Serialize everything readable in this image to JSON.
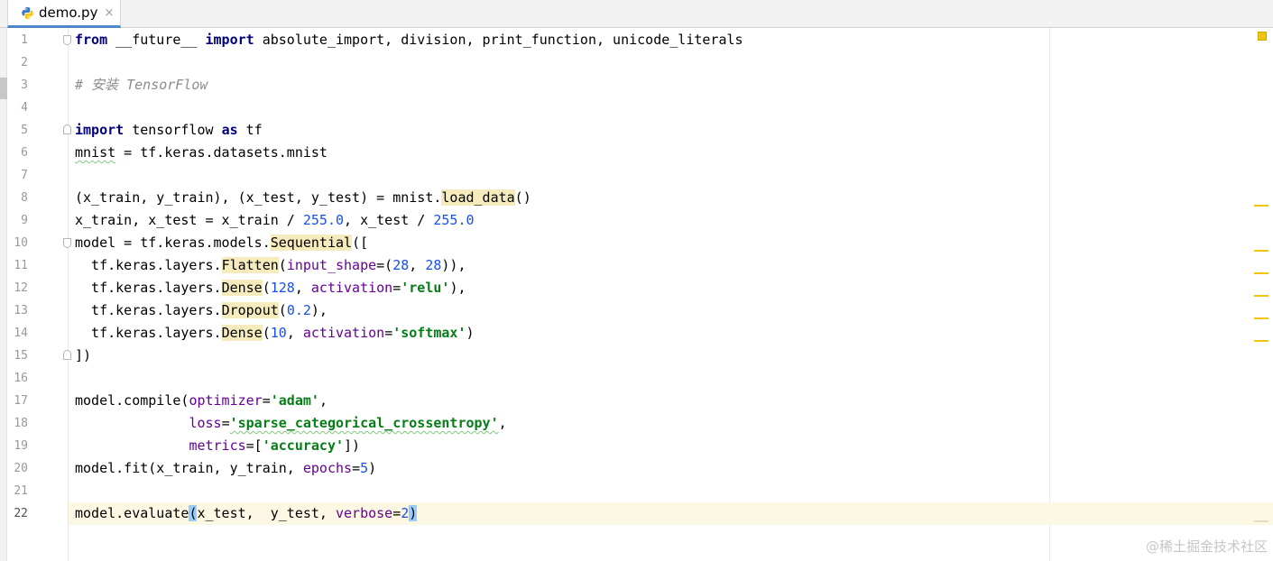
{
  "tab": {
    "file_name": "demo.py",
    "close_glyph": "×",
    "icon": "python-file-icon"
  },
  "colors": {
    "keyword": "#000080",
    "number": "#1750eb",
    "string": "#067d17",
    "kwarg": "#660099",
    "comment": "#8c8c8c",
    "usage_highlight": "#f6ebbc",
    "brace_match": "#99ccff",
    "current_line": "#fdf8e4",
    "warning": "#f1c40f"
  },
  "editor": {
    "current_line": 22,
    "lines": [
      {
        "n": "1",
        "fold": "start",
        "tokens": [
          {
            "t": "from",
            "c": "kw"
          },
          {
            "t": " __future__ "
          },
          {
            "t": "import",
            "c": "kw"
          },
          {
            "t": " absolute_import, division, print_function, unicode_literals"
          }
        ]
      },
      {
        "n": "2",
        "tokens": []
      },
      {
        "n": "3",
        "tokens": [
          {
            "t": "# 安装 TensorFlow",
            "c": "cmt"
          }
        ]
      },
      {
        "n": "4",
        "tokens": []
      },
      {
        "n": "5",
        "fold": "end",
        "tokens": [
          {
            "t": "import",
            "c": "kw"
          },
          {
            "t": " tensorflow "
          },
          {
            "t": "as",
            "c": "kw"
          },
          {
            "t": " tf"
          }
        ]
      },
      {
        "n": "6",
        "tokens": [
          {
            "t": "mnist",
            "c": "typo"
          },
          {
            "t": " = tf.keras.datasets.mnist"
          }
        ]
      },
      {
        "n": "7",
        "tokens": []
      },
      {
        "n": "8",
        "tokens": [
          {
            "t": "(x_train, y_train), (x_test, y_test) = mnist."
          },
          {
            "t": "load_data",
            "c": "hl"
          },
          {
            "t": "()"
          }
        ]
      },
      {
        "n": "9",
        "tokens": [
          {
            "t": "x_train, x_test = x_train / "
          },
          {
            "t": "255.0",
            "c": "num"
          },
          {
            "t": ", x_test / "
          },
          {
            "t": "255.0",
            "c": "num"
          }
        ]
      },
      {
        "n": "10",
        "fold": "start",
        "tokens": [
          {
            "t": "model = tf.keras.models."
          },
          {
            "t": "Sequential",
            "c": "hl"
          },
          {
            "t": "(["
          }
        ]
      },
      {
        "n": "11",
        "tokens": [
          {
            "t": "  tf.keras.layers."
          },
          {
            "t": "Flatten",
            "c": "hl"
          },
          {
            "t": "("
          },
          {
            "t": "input_shape",
            "c": "kwarg"
          },
          {
            "t": "=("
          },
          {
            "t": "28",
            "c": "num"
          },
          {
            "t": ", "
          },
          {
            "t": "28",
            "c": "num"
          },
          {
            "t": ")),"
          }
        ]
      },
      {
        "n": "12",
        "tokens": [
          {
            "t": "  tf.keras.layers."
          },
          {
            "t": "Dense",
            "c": "hl"
          },
          {
            "t": "("
          },
          {
            "t": "128",
            "c": "num"
          },
          {
            "t": ", "
          },
          {
            "t": "activation",
            "c": "kwarg"
          },
          {
            "t": "="
          },
          {
            "t": "'relu'",
            "c": "str"
          },
          {
            "t": "),"
          }
        ]
      },
      {
        "n": "13",
        "tokens": [
          {
            "t": "  tf.keras.layers."
          },
          {
            "t": "Dropout",
            "c": "hl"
          },
          {
            "t": "("
          },
          {
            "t": "0.2",
            "c": "num"
          },
          {
            "t": "),"
          }
        ]
      },
      {
        "n": "14",
        "tokens": [
          {
            "t": "  tf.keras.layers."
          },
          {
            "t": "Dense",
            "c": "hl"
          },
          {
            "t": "("
          },
          {
            "t": "10",
            "c": "num"
          },
          {
            "t": ", "
          },
          {
            "t": "activation",
            "c": "kwarg"
          },
          {
            "t": "="
          },
          {
            "t": "'softmax'",
            "c": "str"
          },
          {
            "t": ")"
          }
        ]
      },
      {
        "n": "15",
        "fold": "end",
        "tokens": [
          {
            "t": "])"
          }
        ]
      },
      {
        "n": "16",
        "tokens": []
      },
      {
        "n": "17",
        "tokens": [
          {
            "t": "model.compile("
          },
          {
            "t": "optimizer",
            "c": "kwarg"
          },
          {
            "t": "="
          },
          {
            "t": "'adam'",
            "c": "str"
          },
          {
            "t": ","
          }
        ]
      },
      {
        "n": "18",
        "tokens": [
          {
            "t": "              "
          },
          {
            "t": "loss",
            "c": "kwarg"
          },
          {
            "t": "="
          },
          {
            "t": "'sparse_categorical_crossentropy'",
            "c": "str typo"
          },
          {
            "t": ","
          }
        ]
      },
      {
        "n": "19",
        "tokens": [
          {
            "t": "              "
          },
          {
            "t": "metrics",
            "c": "kwarg"
          },
          {
            "t": "=["
          },
          {
            "t": "'accuracy'",
            "c": "str"
          },
          {
            "t": "])"
          }
        ]
      },
      {
        "n": "20",
        "tokens": [
          {
            "t": "model.fit(x_train, y_train, "
          },
          {
            "t": "epochs",
            "c": "kwarg"
          },
          {
            "t": "="
          },
          {
            "t": "5",
            "c": "num"
          },
          {
            "t": ")"
          }
        ]
      },
      {
        "n": "21",
        "tokens": []
      },
      {
        "n": "22",
        "tokens": [
          {
            "t": "model.evaluate"
          },
          {
            "t": "(",
            "c": "brace"
          },
          {
            "t": "x_test,  y_test, "
          },
          {
            "t": "verbose",
            "c": "kwarg"
          },
          {
            "t": "="
          },
          {
            "t": "2",
            "c": "num"
          },
          {
            "t": ")",
            "c": "brace"
          }
        ]
      }
    ]
  },
  "watermark": "@稀土掘金技术社区"
}
